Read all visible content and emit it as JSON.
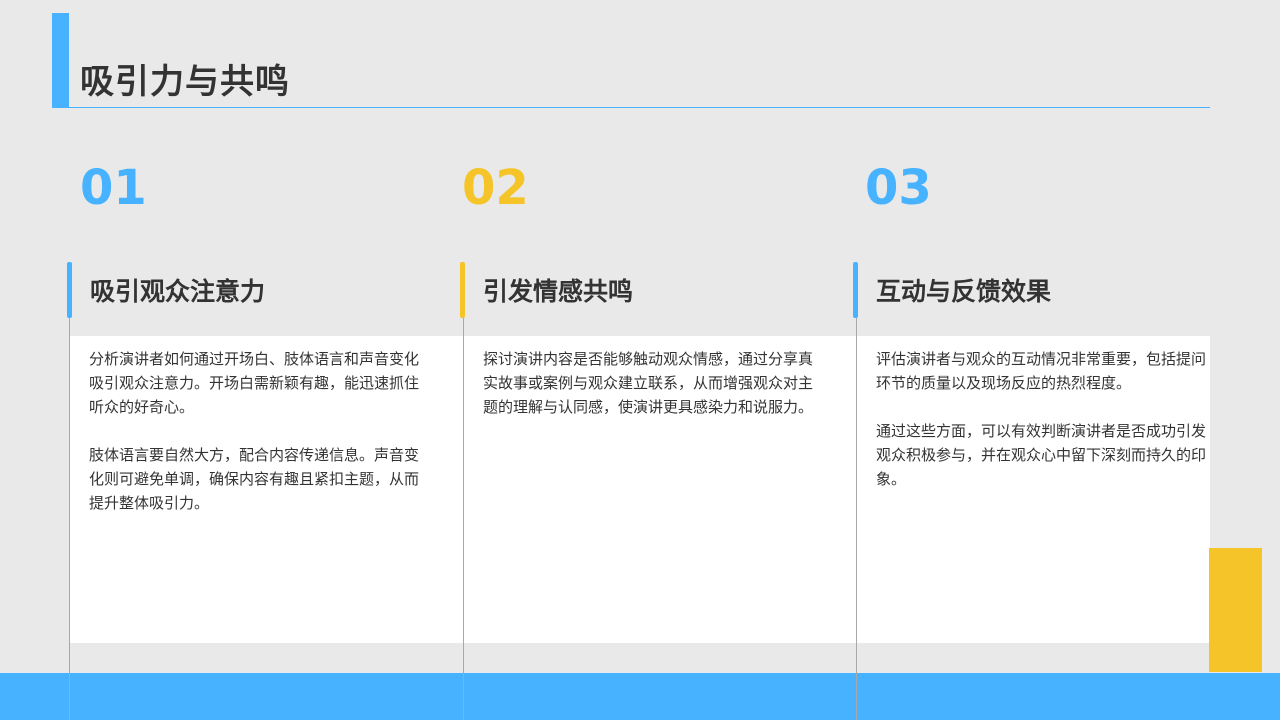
{
  "slide": {
    "title": "吸引力与共鸣"
  },
  "colors": {
    "blue": "#47b2ff",
    "yellow": "#f5c428",
    "background": "#e9e9e9",
    "text": "#333333"
  },
  "columns": [
    {
      "number": "01",
      "number_color": "#47b2ff",
      "heading": "吸引观众注意力",
      "paragraphs": [
        "分析演讲者如何通过开场白、肢体语言和声音变化吸引观众注意力。开场白需新颖有趣，能迅速抓住听众的好奇心。",
        "肢体语言要自然大方，配合内容传递信息。声音变化则可避免单调，确保内容有趣且紧扣主题，从而提升整体吸引力。"
      ]
    },
    {
      "number": "02",
      "number_color": "#f5c428",
      "heading": "引发情感共鸣",
      "paragraphs": [
        "探讨演讲内容是否能够触动观众情感，通过分享真实故事或案例与观众建立联系，从而增强观众对主题的理解与认同感，使演讲更具感染力和说服力。"
      ]
    },
    {
      "number": "03",
      "number_color": "#47b2ff",
      "heading": "互动与反馈效果",
      "paragraphs": [
        "评估演讲者与观众的互动情况非常重要，包括提问环节的质量以及现场反应的热烈程度。",
        "通过这些方面，可以有效判断演讲者是否成功引发观众积极参与，并在观众心中留下深刻而持久的印象。"
      ]
    }
  ]
}
